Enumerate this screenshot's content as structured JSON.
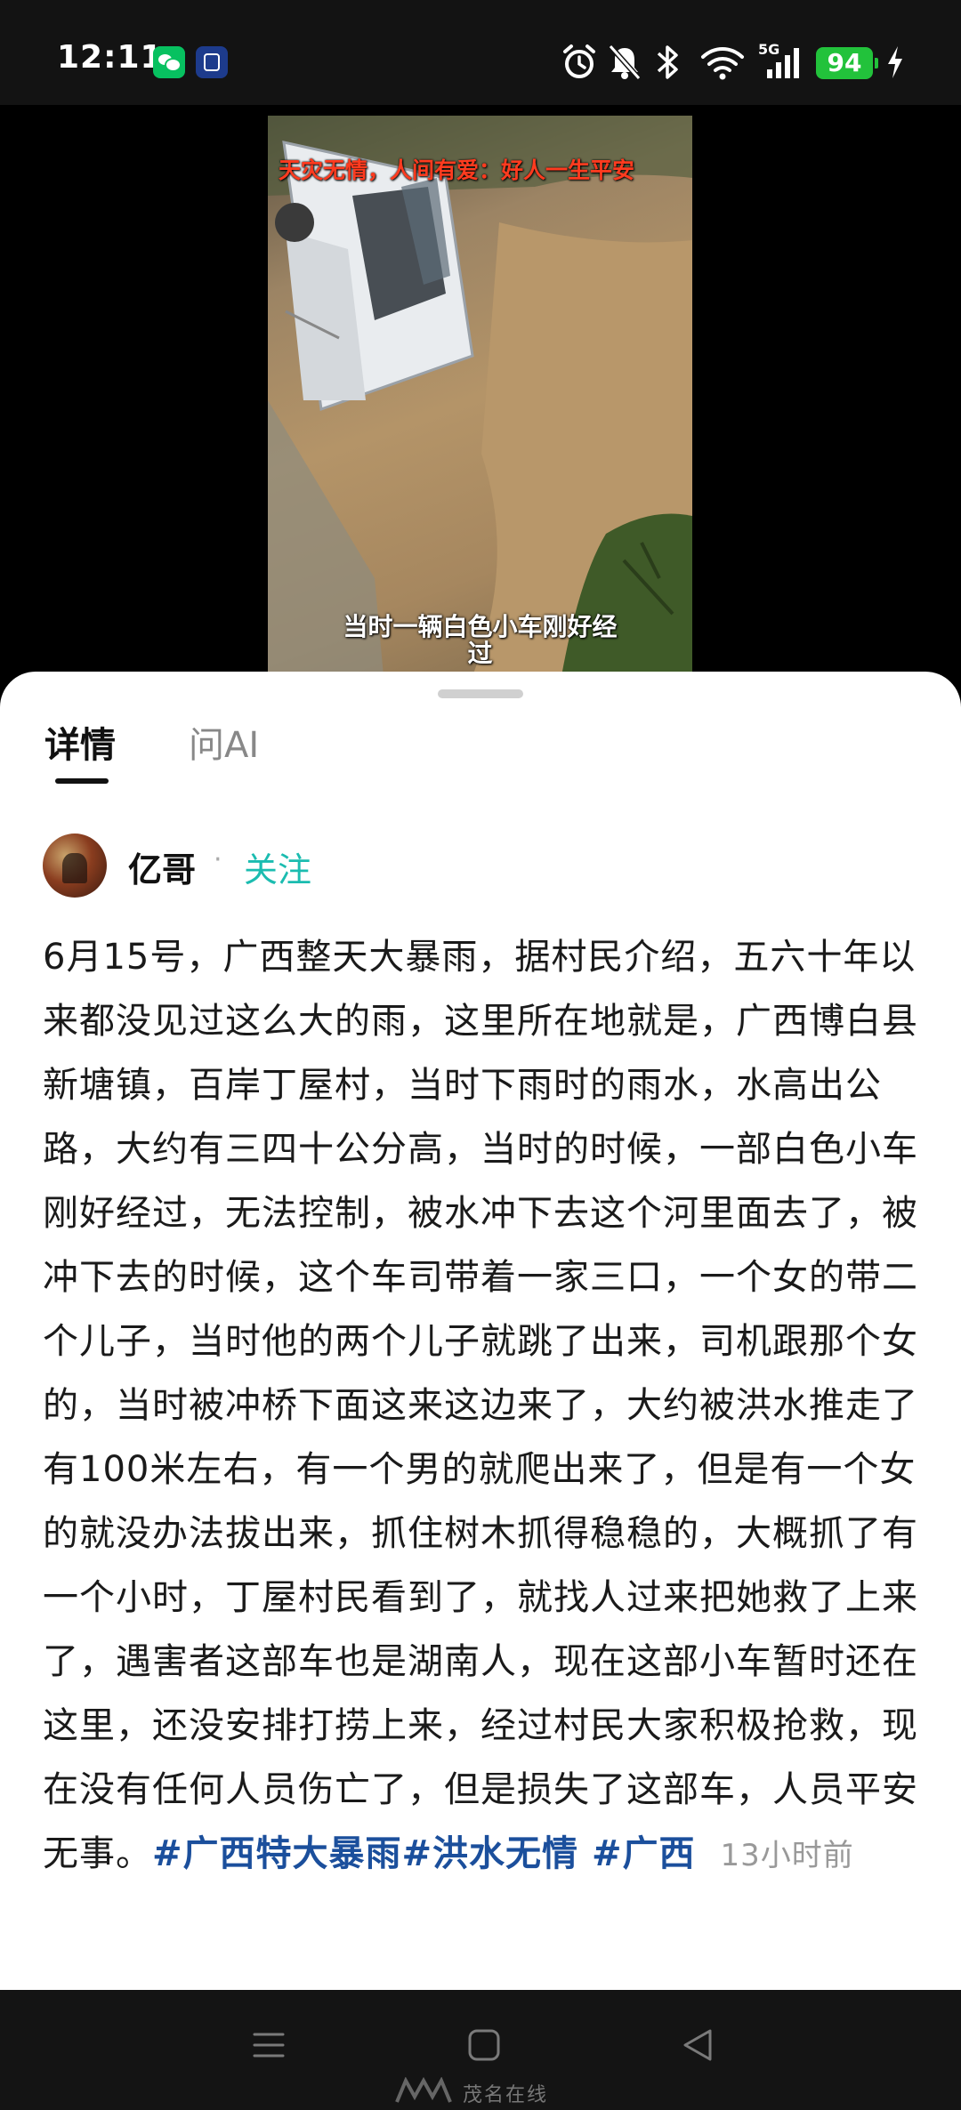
{
  "status_bar": {
    "time": "12:11",
    "network": "5G",
    "battery": "94",
    "icons": [
      "wechat-icon",
      "lock-app-icon",
      "alarm-icon",
      "mute-icon",
      "bluetooth-icon",
      "wifi-icon",
      "signal-icon",
      "charging-icon"
    ]
  },
  "video": {
    "caption_top": "天灾无情，人间有爱：好人一生平安",
    "subtitle_line1": "当时一辆白色小车刚好经",
    "subtitle_line2": "过"
  },
  "tabs": [
    {
      "label": "详情",
      "active": true
    },
    {
      "label": "问AI",
      "active": false
    }
  ],
  "author": {
    "name": "亿哥",
    "separator": "·",
    "follow_label": "关注"
  },
  "post": {
    "text": "6月15号，广西整天大暴雨，据村民介绍，五六十年以来都没见过这么大的雨，这里所在地就是，广西博白县新塘镇，百岸丁屋村，当时下雨时的雨水，水高出公路，大约有三四十公分高，当时的时候，一部白色小车刚好经过，无法控制，被水冲下去这个河里面去了，被冲下去的时候，这个车司带着一家三口，一个女的带二个儿子，当时他的两个儿子就跳了出来，司机跟那个女的，当时被冲桥下面这来这边来了，大约被洪水推走了有100米左右，有一个男的就爬出来了，但是有一个女的就没办法拔出来，抓住树木抓得稳稳的，大概抓了有一个小时，丁屋村民看到了，就找人过来把她救了上来了，遇害者这部车也是湖南人，现在这部小车暂时还在这里，还没安排打捞上来，经过村民大家积极抢救，现在没有任何人员伤亡了，但是损失了这部车，人员平安无事。",
    "hashtags": [
      "#广西特大暴雨",
      "#洪水无情",
      " #广西"
    ],
    "timestamp": "13小时前"
  },
  "nav": {
    "watermark": "茂名在线"
  },
  "colors": {
    "accent": "#1bbcb0",
    "hashtag": "#1b4f9c",
    "battery": "#22c23b"
  }
}
